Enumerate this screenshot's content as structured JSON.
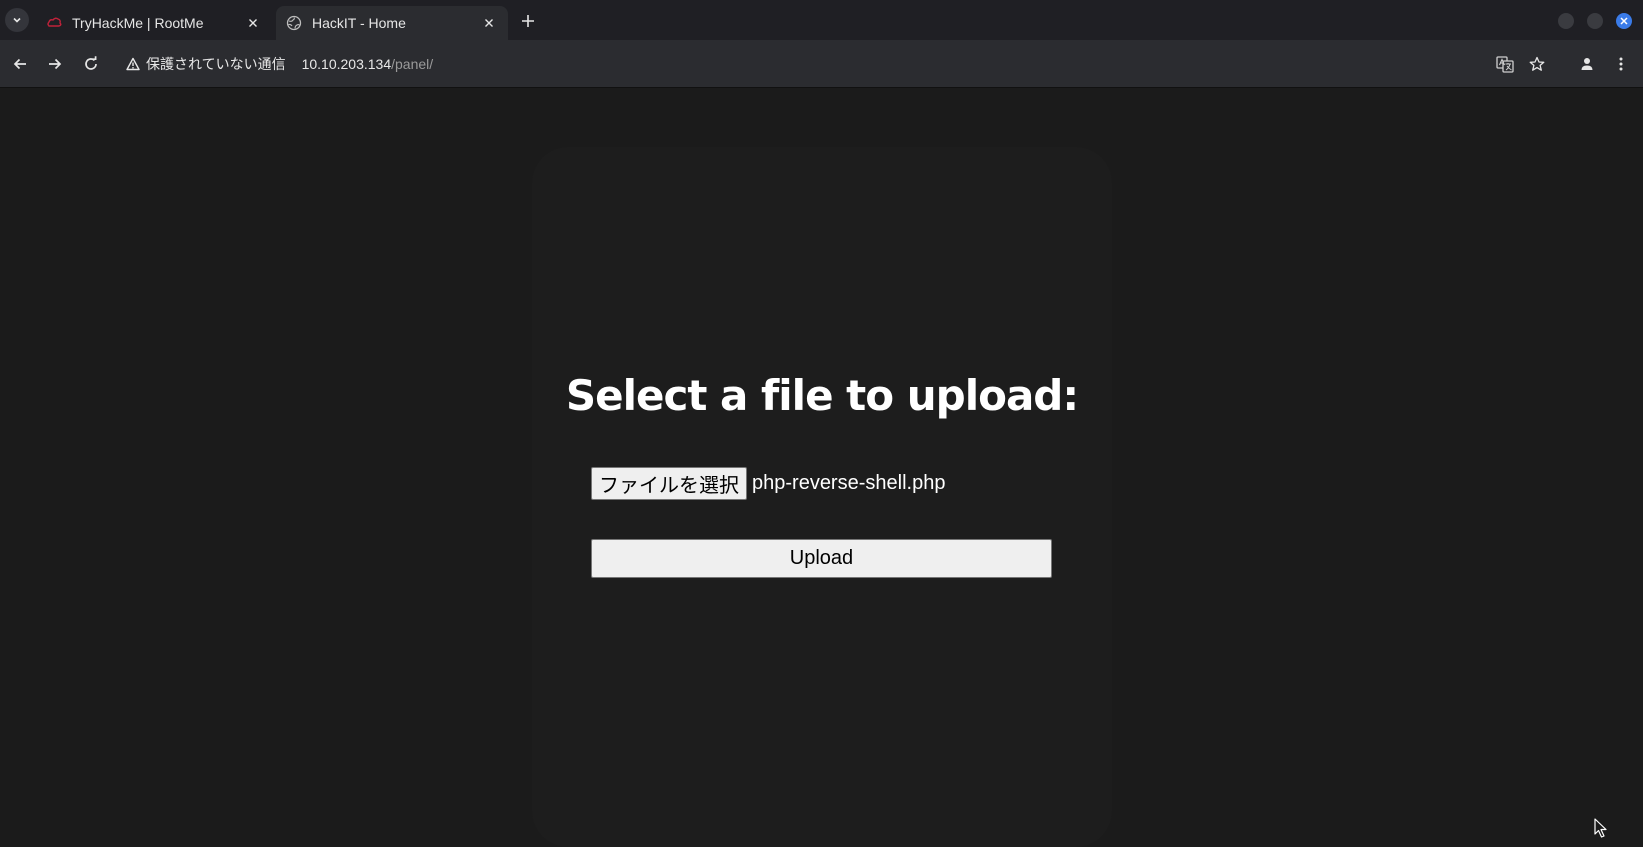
{
  "browser": {
    "tabs": [
      {
        "title": "TryHackMe | RootMe",
        "active": false
      },
      {
        "title": "HackIT - Home",
        "active": true
      }
    ],
    "address": {
      "security_label": "保護されていない通信",
      "host": "10.10.203.134",
      "path": "/panel/"
    },
    "colors": {
      "tabstrip": "#1f1f24",
      "toolbar": "#2b2c30",
      "close_button": "#3a7be8",
      "tryhackme_favicon": "#c0223a"
    }
  },
  "page": {
    "heading": "Select a file to upload:",
    "file_button_label": "ファイルを選択",
    "file_name": "php-reverse-shell.php",
    "upload_label": "Upload",
    "background": "#1b1b1b"
  }
}
